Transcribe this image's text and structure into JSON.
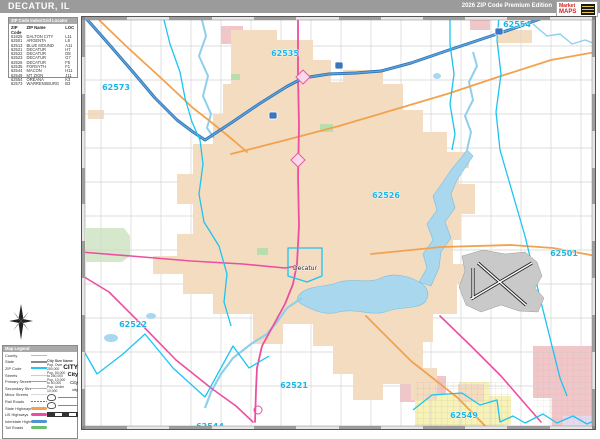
{
  "title_bar": {
    "title": "DECATUR, IL",
    "edition": "2026 ZIP Code Premium Edition"
  },
  "logo": {
    "name": "MarketMAPS",
    "line1": "Market",
    "line2": "MAPS"
  },
  "index_table": {
    "header": "ZIP Code Index/Grid Locator",
    "columns": {
      "zip": "ZIP Code",
      "name": "ZIP Name",
      "loc": "LOC"
    },
    "rows": [
      {
        "zip": "61825",
        "name": "DALTON CITY",
        "loc": "L11"
      },
      {
        "zip": "62501",
        "name": "ARGENTA",
        "loc": "L8"
      },
      {
        "zip": "62513",
        "name": "BLUE MOUND",
        "loc": "A11"
      },
      {
        "zip": "62521",
        "name": "DECATUR",
        "loc": "H7"
      },
      {
        "zip": "62522",
        "name": "DECATUR",
        "loc": "D8"
      },
      {
        "zip": "62523",
        "name": "DECATUR",
        "loc": "G7"
      },
      {
        "zip": "62526",
        "name": "DECATUR",
        "loc": "F5"
      },
      {
        "zip": "62535",
        "name": "FORSYTH",
        "loc": "F1"
      },
      {
        "zip": "62544",
        "name": "MACON",
        "loc": "H11"
      },
      {
        "zip": "62549",
        "name": "MT ZION",
        "loc": "J11"
      },
      {
        "zip": "62554",
        "name": "OREANA",
        "loc": "K3"
      },
      {
        "zip": "62573",
        "name": "WARRENSBURG",
        "loc": "B3"
      }
    ]
  },
  "map": {
    "city_label": "Decatur",
    "zip_labels": [
      {
        "text": "62535"
      },
      {
        "text": "62573"
      },
      {
        "text": "62554"
      },
      {
        "text": "62526"
      },
      {
        "text": "62501"
      },
      {
        "text": "62522"
      },
      {
        "text": "62521"
      },
      {
        "text": "62544"
      },
      {
        "text": "62549"
      }
    ]
  },
  "legend": {
    "header": "Map Legend",
    "road_items": [
      {
        "label": "County"
      },
      {
        "label": "State"
      },
      {
        "label": "ZIP Code"
      },
      {
        "label": "Streets"
      },
      {
        "label": "Primary Streets"
      },
      {
        "label": "Secondary Streets"
      },
      {
        "label": "Minor Streets"
      },
      {
        "label": "Rail Roads"
      },
      {
        "label": "State Highways"
      },
      {
        "label": "US Highways"
      },
      {
        "label": "Interstate Highways"
      },
      {
        "label": "Toll Roads"
      }
    ],
    "city_size_header": "City Size Name",
    "city_sizes": [
      {
        "pop": "Pop. Over 250,000",
        "sample": "CITY"
      },
      {
        "pop": "Pop. 50,000 to 250,000",
        "sample": "City"
      },
      {
        "pop": "Pop. 10,000 to 50,000",
        "sample": "City"
      },
      {
        "pop": "Pop. Under 10,000",
        "sample": "city"
      }
    ]
  },
  "colors": {
    "urban_tan": "#f4dcc1",
    "water_blue": "#a9d7ee",
    "zip_cyan": "#1cc4f1",
    "us_hwy_pink": "#ec4fa0",
    "state_hwy_orange": "#f2a24e",
    "interstate_blue": "#4f94d4",
    "suburb_pink": "#f0c6c9",
    "suburb_yellow": "#f6f2b8",
    "park_green": "#d6e8cc"
  }
}
